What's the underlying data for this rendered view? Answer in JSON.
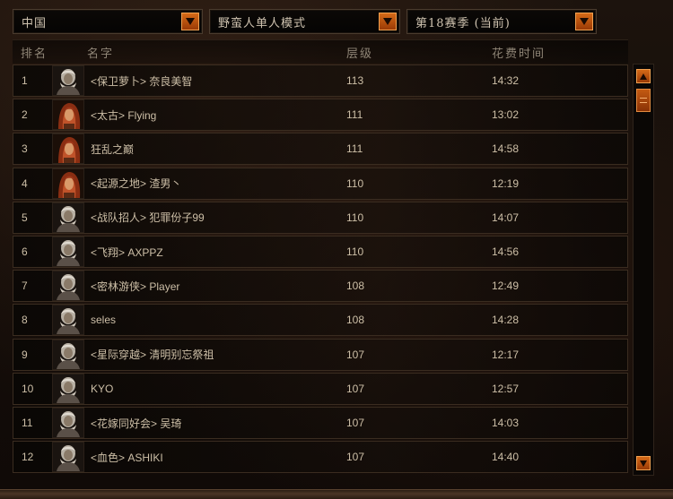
{
  "filters": {
    "region": "中国",
    "mode": "野蛮人单人模式",
    "season": "第18赛季 (当前)"
  },
  "columns": {
    "rank": "排名",
    "name": "名字",
    "tier": "层级",
    "time": "花费时间"
  },
  "rows": [
    {
      "rank": "1",
      "name": "<保卫萝卜> 奈良美智",
      "tier": "113",
      "time": "14:32",
      "portrait": "male-barbarian-portrait-icon"
    },
    {
      "rank": "2",
      "name": "<太古> Flying",
      "tier": "111",
      "time": "13:02",
      "portrait": "female-barbarian-portrait-icon"
    },
    {
      "rank": "3",
      "name": "狂乱之巅",
      "tier": "111",
      "time": "14:58",
      "portrait": "female-barbarian-portrait-icon"
    },
    {
      "rank": "4",
      "name": "<起源之地> 渣男丶",
      "tier": "110",
      "time": "12:19",
      "portrait": "female-barbarian-portrait-icon"
    },
    {
      "rank": "5",
      "name": "<战队招人> 犯罪份子99",
      "tier": "110",
      "time": "14:07",
      "portrait": "male-barbarian-portrait-icon"
    },
    {
      "rank": "6",
      "name": "<飞翔> AXPPZ",
      "tier": "110",
      "time": "14:56",
      "portrait": "male-barbarian-portrait-icon"
    },
    {
      "rank": "7",
      "name": "<密林游侠> Player",
      "tier": "108",
      "time": "12:49",
      "portrait": "male-barbarian-portrait-icon"
    },
    {
      "rank": "8",
      "name": "seles",
      "tier": "108",
      "time": "14:28",
      "portrait": "male-barbarian-portrait-icon"
    },
    {
      "rank": "9",
      "name": "<星际穿越> 清明别忘祭祖",
      "tier": "107",
      "time": "12:17",
      "portrait": "male-barbarian-portrait-icon"
    },
    {
      "rank": "10",
      "name": "KYO",
      "tier": "107",
      "time": "12:57",
      "portrait": "male-barbarian-portrait-icon"
    },
    {
      "rank": "11",
      "name": "<花嫁同好会> 吴琦",
      "tier": "107",
      "time": "14:03",
      "portrait": "male-barbarian-portrait-icon"
    },
    {
      "rank": "12",
      "name": "<血色> ASHIKI",
      "tier": "107",
      "time": "14:40",
      "portrait": "male-barbarian-portrait-icon"
    }
  ],
  "colors": {
    "accent": "#c9581a",
    "text": "#cdbfa7",
    "header_text": "#8f8576",
    "row_border": "#3a2c20"
  }
}
